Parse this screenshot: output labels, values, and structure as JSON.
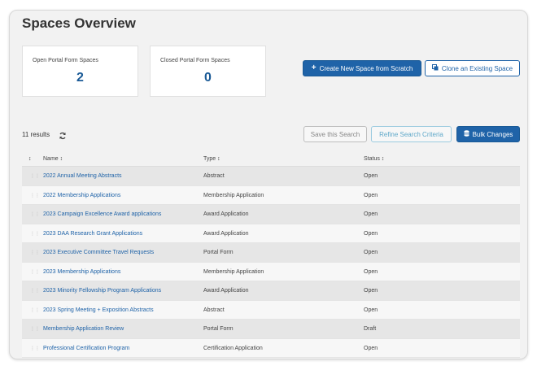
{
  "page": {
    "title": "Spaces Overview"
  },
  "stats": [
    {
      "label": "Open Portal Form Spaces",
      "value": "2"
    },
    {
      "label": "Closed Portal Form Spaces",
      "value": "0"
    }
  ],
  "actions": {
    "create_label": "Create New Space from Scratch",
    "clone_label": "Clone an Existing Space",
    "save_search_label": "Save this Search",
    "refine_label": "Refine Search Criteria",
    "bulk_label": "Bulk Changes"
  },
  "results": {
    "count_text": "11 results"
  },
  "table": {
    "headers": {
      "sort": "↕",
      "name": "Name ↕",
      "type": "Type ↕",
      "status": "Status ↕"
    },
    "rows": [
      {
        "name": "2022 Annual Meeting Abstracts",
        "type": "Abstract",
        "status": "Open"
      },
      {
        "name": "2022 Membership Applications",
        "type": "Membership Application",
        "status": "Open"
      },
      {
        "name": "2023 Campaign Excellence Award applications",
        "type": "Award Application",
        "status": "Open"
      },
      {
        "name": "2023 DAA Research Grant Applications",
        "type": "Award Application",
        "status": "Open"
      },
      {
        "name": "2023 Executive Committee Travel Requests",
        "type": "Portal Form",
        "status": "Open"
      },
      {
        "name": "2023 Membership Applications",
        "type": "Membership Application",
        "status": "Open"
      },
      {
        "name": "2023 Minority Fellowship Program Applications",
        "type": "Award Application",
        "status": "Open"
      },
      {
        "name": "2023 Spring Meeting + Exposition Abstracts",
        "type": "Abstract",
        "status": "Open"
      },
      {
        "name": "Membership Application Review",
        "type": "Portal Form",
        "status": "Draft"
      },
      {
        "name": "Professional Certification Program",
        "type": "Certification Application",
        "status": "Open"
      }
    ]
  },
  "icons": {
    "plus": "plus-icon",
    "clone": "copy-icon",
    "refresh": "refresh-icon",
    "bulk": "database-icon",
    "grip": "drag-handle-icon"
  },
  "colors": {
    "primary": "#1f63a8",
    "stat_value": "#1a5a96",
    "link": "#1f63a8"
  }
}
